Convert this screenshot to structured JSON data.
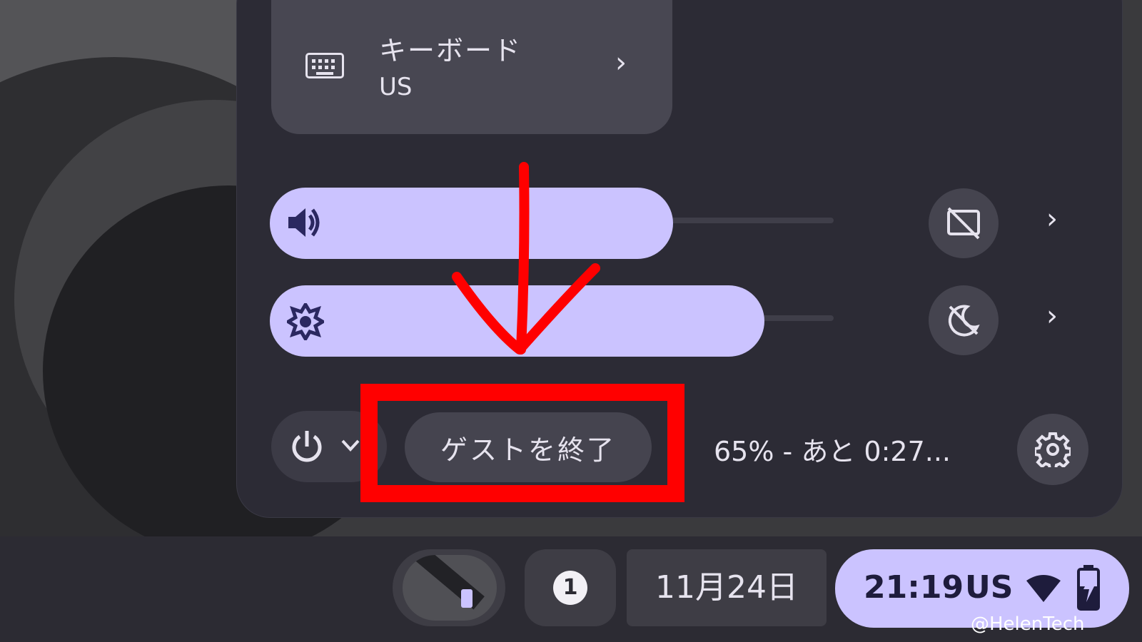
{
  "quick_settings": {
    "keyboard_tile": {
      "title": "キーボード",
      "subtitle": "US",
      "icon": "keyboard-icon"
    },
    "volume_slider": {
      "icon": "volume-icon",
      "level_percent": 73
    },
    "brightness_slider": {
      "icon": "brightness-icon",
      "level_percent": 87
    },
    "cast_button": {
      "icon": "cast-off-icon"
    },
    "night_light_button": {
      "icon": "night-light-off-icon"
    },
    "power_menu": {
      "icon": "power-icon"
    },
    "exit_guest_label": "ゲストを終了",
    "battery_text": "65% - あと 0:27...",
    "settings_icon": "gear-icon"
  },
  "shelf": {
    "notification_count": "1",
    "date": "11月24日",
    "time": "21:19",
    "ime": "US",
    "wifi_icon": "wifi-icon",
    "battery_icon": "battery-charging-icon"
  },
  "annotations": {
    "watermark": "@HelenTech",
    "highlight_color": "#ff0000"
  },
  "colors": {
    "accent": "#cbc3ff",
    "panel": "#2c2b35",
    "tile": "#484752"
  }
}
